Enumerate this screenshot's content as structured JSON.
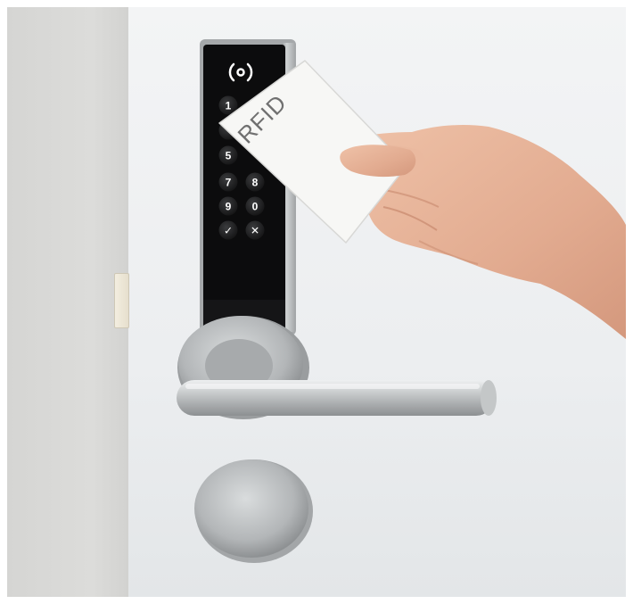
{
  "photo": {
    "subject": "rfid-keypad-door-lock",
    "keypad": {
      "status_icon": "contactless-signal-icon",
      "keys": [
        "1",
        "5",
        "7",
        "8",
        "9",
        "0",
        "✓",
        "✕"
      ]
    },
    "card": {
      "label": "RFID"
    }
  },
  "colors": {
    "keypad_face": "#0c0c0d",
    "metal": "#b9bcbe",
    "card": "#f7f7f5",
    "skin": "#e7b49a",
    "door": "#eceef0",
    "wall": "#d8d8d6"
  }
}
